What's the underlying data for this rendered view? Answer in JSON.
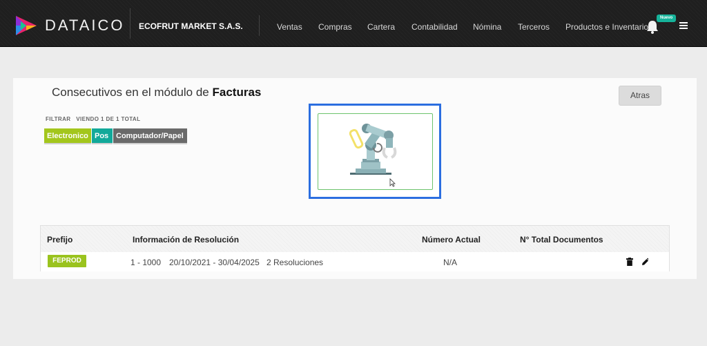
{
  "header": {
    "brand": "DATAICO",
    "company": "ECOFRUT MARKET S.A.S.",
    "nav": [
      {
        "label": "Ventas"
      },
      {
        "label": "Compras"
      },
      {
        "label": "Cartera"
      },
      {
        "label": "Contabilidad"
      },
      {
        "label": "Nómina"
      },
      {
        "label": "Terceros"
      },
      {
        "label": "Productos e Inventario"
      }
    ],
    "badge": "Nuevo",
    "icons": {
      "notifications": "bell-icon",
      "menu": "hamburger-menu-icon"
    }
  },
  "page": {
    "title_prefix": "Consecutivos en el módulo de ",
    "title_bold": "Facturas",
    "back_button": "Atras",
    "filter_text": "FILTRAR   VIENDO 1 DE 1 TOTAL",
    "filters": [
      {
        "label": "Electronico",
        "color": "#a3c61c"
      },
      {
        "label": "Pos",
        "color": "#12a99a"
      },
      {
        "label": "Computador/Papel",
        "color": "#6a6a6a"
      }
    ]
  },
  "table": {
    "headers": {
      "prefix": "Prefijo",
      "resolution": "Información de Resolución",
      "current": "Número Actual",
      "total": "N° Total Documentos"
    },
    "rows": [
      {
        "prefix": "FEPROD",
        "range": "1 - 1000",
        "dates": "20/10/2021 - 30/04/2025",
        "resolutions": "2 Resoluciones",
        "current": "N/A",
        "total": ""
      }
    ],
    "row_actions": [
      "trash-icon",
      "pencil-icon"
    ]
  },
  "colors": {
    "accent_blue": "#2b6ee0",
    "green": "#9ac31e",
    "teal": "#12a99a",
    "topbar": "#1f1f1f"
  }
}
